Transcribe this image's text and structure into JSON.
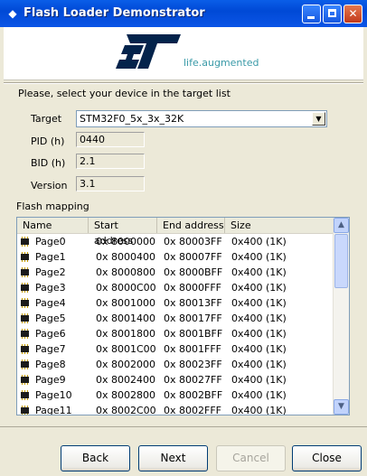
{
  "window": {
    "title": "Flash Loader Demonstrator"
  },
  "header": {
    "tagline": "life.augmented"
  },
  "form": {
    "prompt": "Please, select your device in the target list",
    "target_label": "Target",
    "target_value": "STM32F0_5x_3x_32K",
    "pid_label": "PID  (h)",
    "pid_value": "0440",
    "bid_label": "BID  (h)",
    "bid_value": "2.1",
    "version_label": "Version",
    "version_value": "3.1"
  },
  "flash_mapping": {
    "label": "Flash mapping",
    "columns": [
      "Name",
      "Start address",
      "End address",
      "Size"
    ],
    "rows": [
      {
        "name": "Page0",
        "start": "0x 8000000",
        "end": "0x 80003FF",
        "size": "0x400 (1K)"
      },
      {
        "name": "Page1",
        "start": "0x 8000400",
        "end": "0x 80007FF",
        "size": "0x400 (1K)"
      },
      {
        "name": "Page2",
        "start": "0x 8000800",
        "end": "0x 8000BFF",
        "size": "0x400 (1K)"
      },
      {
        "name": "Page3",
        "start": "0x 8000C00",
        "end": "0x 8000FFF",
        "size": "0x400 (1K)"
      },
      {
        "name": "Page4",
        "start": "0x 8001000",
        "end": "0x 80013FF",
        "size": "0x400 (1K)"
      },
      {
        "name": "Page5",
        "start": "0x 8001400",
        "end": "0x 80017FF",
        "size": "0x400 (1K)"
      },
      {
        "name": "Page6",
        "start": "0x 8001800",
        "end": "0x 8001BFF",
        "size": "0x400 (1K)"
      },
      {
        "name": "Page7",
        "start": "0x 8001C00",
        "end": "0x 8001FFF",
        "size": "0x400 (1K)"
      },
      {
        "name": "Page8",
        "start": "0x 8002000",
        "end": "0x 80023FF",
        "size": "0x400 (1K)"
      },
      {
        "name": "Page9",
        "start": "0x 8002400",
        "end": "0x 80027FF",
        "size": "0x400 (1K)"
      },
      {
        "name": "Page10",
        "start": "0x 8002800",
        "end": "0x 8002BFF",
        "size": "0x400 (1K)"
      },
      {
        "name": "Page11",
        "start": "0x 8002C00",
        "end": "0x 8002FFF",
        "size": "0x400 (1K)"
      }
    ]
  },
  "buttons": {
    "back": "Back",
    "next": "Next",
    "cancel": "Cancel",
    "close": "Close"
  },
  "colors": {
    "title_bar": "#0a5ee8",
    "logo_blue": "#03234b",
    "logo_accent": "#3a9aa8"
  },
  "icons": [
    "app-icon",
    "minimize-icon",
    "maximize-icon",
    "close-icon",
    "chip-icon",
    "dropdown-arrow-icon",
    "scroll-up-icon",
    "scroll-down-icon"
  ]
}
